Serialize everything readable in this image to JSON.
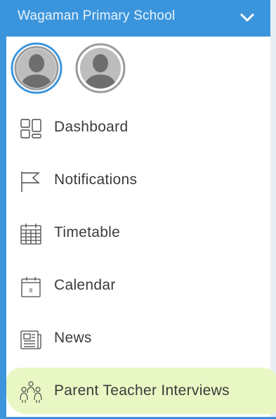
{
  "header": {
    "school_name": "Wagaman Primary School",
    "chevron_icon": "chevron-down-icon"
  },
  "avatars": [
    {
      "icon": "user-avatar-icon",
      "selected": true
    },
    {
      "icon": "user-avatar-icon",
      "selected": false
    }
  ],
  "menu": {
    "items": [
      {
        "label": "Dashboard",
        "icon": "dashboard-icon"
      },
      {
        "label": "Notifications",
        "icon": "flag-icon"
      },
      {
        "label": "Timetable",
        "icon": "timetable-icon"
      },
      {
        "label": "Calendar",
        "icon": "calendar-icon"
      },
      {
        "label": "News",
        "icon": "newspaper-icon"
      },
      {
        "label": "Parent Teacher Interviews",
        "icon": "people-icon",
        "highlighted": true
      }
    ]
  },
  "calendar_icon_day": "8",
  "colors": {
    "accent": "#3b95dd",
    "avatar_ring_selected": "#3b95dd",
    "highlight": "#e9f7c4",
    "text": "#3b3b3b"
  }
}
